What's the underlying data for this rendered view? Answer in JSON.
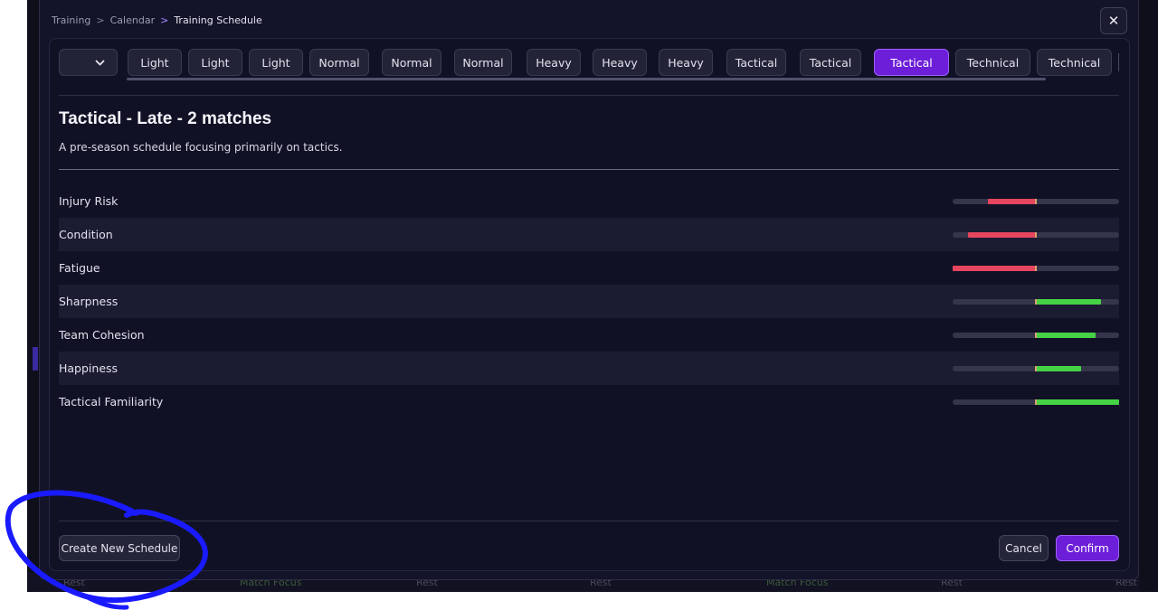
{
  "breadcrumb": {
    "items": [
      "Training",
      "Calendar"
    ],
    "current": "Training Schedule"
  },
  "close_label": "✕",
  "dropdown_icon": "chevron-down-icon",
  "tabs": [
    {
      "label": "Light"
    },
    {
      "label": "Light"
    },
    {
      "label": "Light"
    },
    {
      "label": "Normal"
    },
    {
      "label": "Normal"
    },
    {
      "label": "Normal"
    },
    {
      "label": "Heavy"
    },
    {
      "label": "Heavy"
    },
    {
      "label": "Heavy"
    },
    {
      "label": "Tactical"
    },
    {
      "label": "Tactical"
    },
    {
      "label": "Tactical",
      "selected": true
    },
    {
      "label": "Technical"
    },
    {
      "label": "Technical"
    }
  ],
  "schedule": {
    "title": "Tactical - Late - 2 matches",
    "description": "A pre-season schedule focusing primarily on tactics."
  },
  "stats": [
    {
      "label": "Injury Risk",
      "direction": "negative",
      "change_fraction": 0.29
    },
    {
      "label": "Condition",
      "direction": "negative",
      "change_fraction": 0.41
    },
    {
      "label": "Fatigue",
      "direction": "negative",
      "change_fraction": 0.5
    },
    {
      "label": "Sharpness",
      "direction": "positive",
      "change_fraction": 0.39
    },
    {
      "label": "Team Cohesion",
      "direction": "positive",
      "change_fraction": 0.36
    },
    {
      "label": "Happiness",
      "direction": "positive",
      "change_fraction": 0.27
    },
    {
      "label": "Tactical Familiarity",
      "direction": "positive",
      "change_fraction": 0.5
    }
  ],
  "footer": {
    "create_label": "Create New Schedule",
    "cancel_label": "Cancel",
    "confirm_label": "Confirm"
  },
  "background_strip": [
    {
      "label": "Rest"
    },
    {
      "label": "Match Focus"
    },
    {
      "label": "Rest"
    },
    {
      "label": "Rest"
    },
    {
      "label": "Match Focus"
    },
    {
      "label": "Rest"
    },
    {
      "label": "Rest"
    }
  ],
  "colors": {
    "accent": "#6c1ed8",
    "negative": "#e6455e",
    "positive": "#45d345",
    "annotation": "#1a1aff"
  }
}
